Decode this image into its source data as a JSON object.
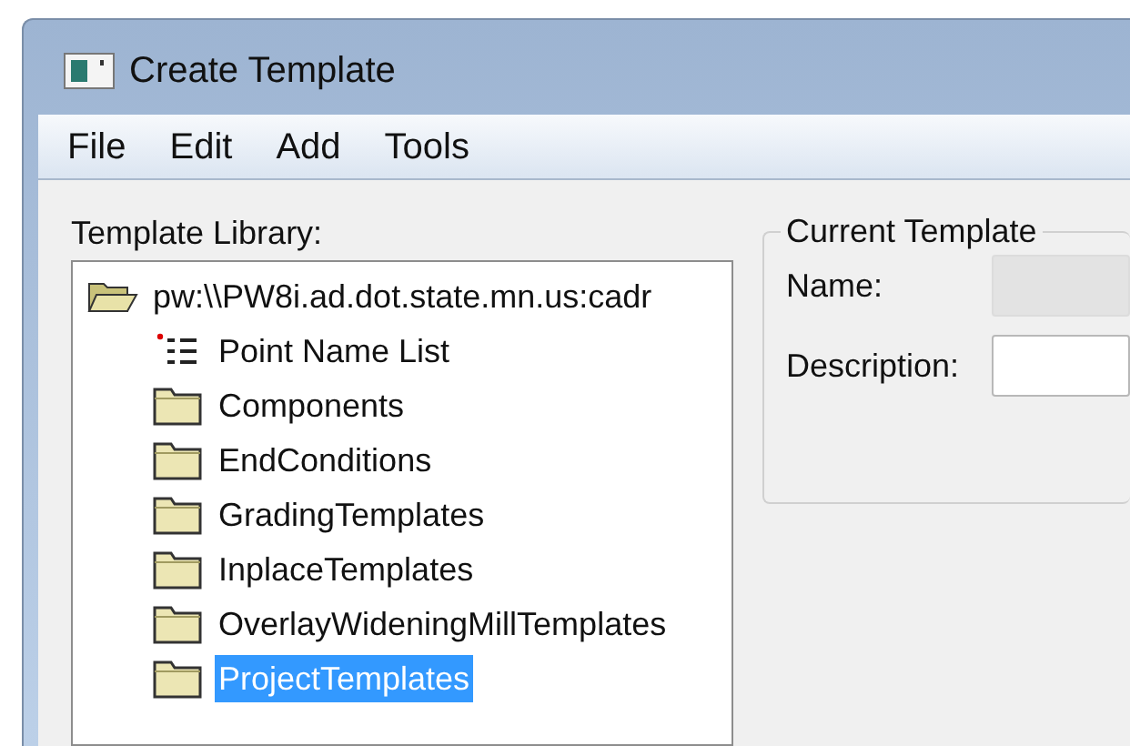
{
  "window": {
    "title": "Create Template"
  },
  "menu": [
    "File",
    "Edit",
    "Add",
    "Tools"
  ],
  "library": {
    "label": "Template Library:",
    "tree": [
      {
        "label": "pw:\\\\PW8i.ad.dot.state.mn.us:cadr",
        "kind": "open-folder",
        "selected": false,
        "children": [
          {
            "label": "Point Name List",
            "kind": "list",
            "selected": false
          },
          {
            "label": "Components",
            "kind": "folder",
            "selected": false
          },
          {
            "label": "EndConditions",
            "kind": "folder",
            "selected": false
          },
          {
            "label": "GradingTemplates",
            "kind": "folder",
            "selected": false
          },
          {
            "label": "InplaceTemplates",
            "kind": "folder",
            "selected": false
          },
          {
            "label": "OverlayWideningMillTemplates",
            "kind": "folder",
            "selected": false
          },
          {
            "label": "ProjectTemplates",
            "kind": "folder",
            "selected": true
          }
        ]
      }
    ]
  },
  "current_template": {
    "title": "Current Template",
    "fields": [
      {
        "label": "Name:",
        "disabled": true
      },
      {
        "label": "Description:",
        "disabled": false
      }
    ]
  }
}
